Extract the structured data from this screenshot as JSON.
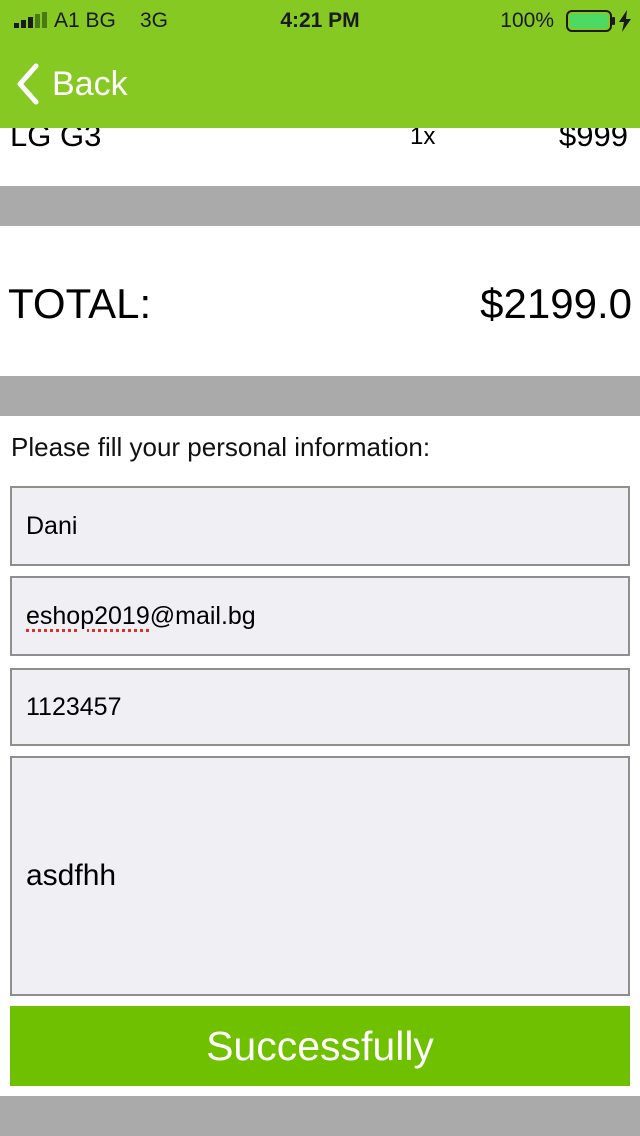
{
  "status_bar": {
    "carrier": "A1 BG",
    "network": "3G",
    "time": "4:21 PM",
    "battery_percent": "100%",
    "battery_color": "#4cd964"
  },
  "nav": {
    "back_label": "Back",
    "back_icon": "chevron-left-icon",
    "bar_color": "#86c923"
  },
  "cart": {
    "item": {
      "name": "LG G3",
      "quantity": "1x",
      "price": "$999"
    }
  },
  "total": {
    "label": "TOTAL:",
    "value": "$2199.0"
  },
  "form": {
    "title": "Please fill your personal information:",
    "name_value": "Dani",
    "email_value_misspelled": "eshop2019",
    "email_value_rest": "@mail.bg",
    "phone_value": "1123457",
    "text_value": "asdfhh"
  },
  "submit": {
    "label": "Successfully",
    "color": "#6fc100"
  }
}
